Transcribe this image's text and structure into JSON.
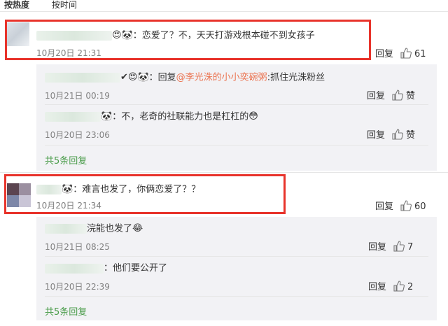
{
  "sort": {
    "hot": "按热度",
    "time": "按时间"
  },
  "comments": [
    {
      "text": "：恋爱了？不，天天打游戏根本碰不到女孩子",
      "time": "10月20日 21:31",
      "reply_label": "回复",
      "likes": "61"
    },
    {
      "text": "：难言也发了，你俩恋爱了？？",
      "time": "10月20日 21:34",
      "reply_label": "回复",
      "likes": "60"
    }
  ],
  "replies1": [
    {
      "prefix": "：回复",
      "mention": "@李光洙的小小奕碗粥",
      "suffix": ":抓住光洙粉丝",
      "time": "10月21日 00:19",
      "reply_label": "回复",
      "likes": "赞"
    },
    {
      "text": "：不，老奇的社联能力也是杠杠的",
      "time": "10月20日 23:06",
      "reply_label": "回复",
      "likes": "赞"
    }
  ],
  "replies2": [
    {
      "text": "浣能也发了",
      "time": "10月21日 08:25",
      "reply_label": "回复",
      "likes": "7"
    },
    {
      "text": "：他们要公开了",
      "time": "10月20日 22:39",
      "reply_label": "回复",
      "likes": "2"
    }
  ],
  "more1": "共5条回复",
  "more2": "共5条回复",
  "colors": {
    "highlight": "#e8332b",
    "link": "#eb7350",
    "green": "#4a9c4a",
    "panel": "#f2f2f5"
  },
  "icons": [
    "panda-emoji-icon",
    "thumbs-up-icon",
    "heart-eyes-emoji-icon",
    "laughing-emoji-icon",
    "blushing-emoji-icon"
  ]
}
